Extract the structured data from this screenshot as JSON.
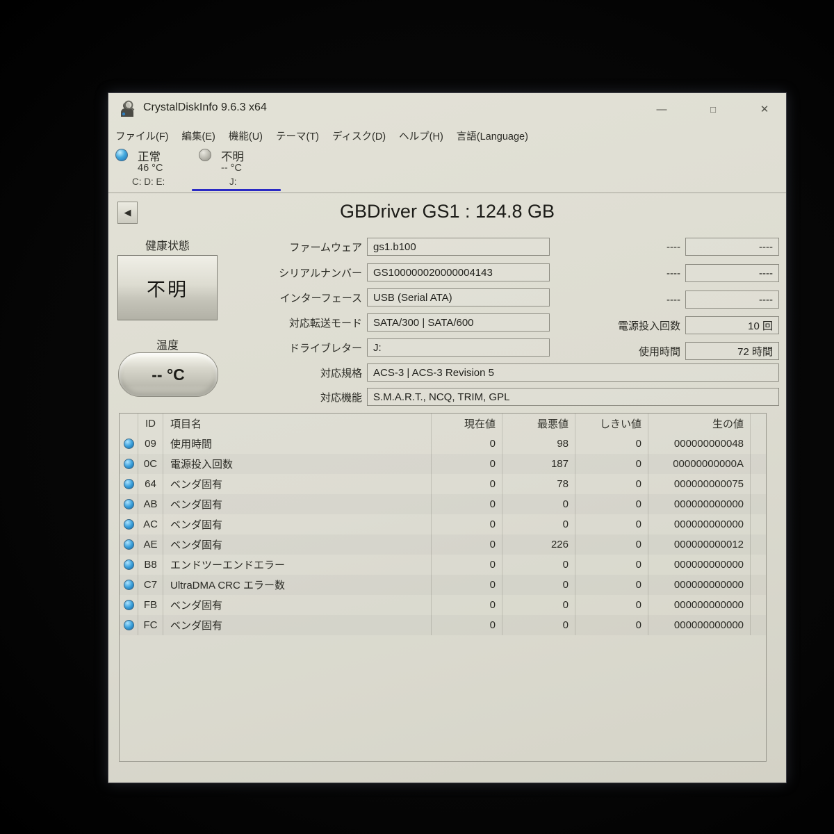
{
  "titlebar": {
    "title": "CrystalDiskInfo 9.6.3 x64",
    "minimize": "—",
    "maximize": "□",
    "close": "✕"
  },
  "menu": {
    "items": [
      {
        "label": "ファイル(F)"
      },
      {
        "label": "編集(E)"
      },
      {
        "label": "機能(U)"
      },
      {
        "label": "テーマ(T)"
      },
      {
        "label": "ディスク(D)"
      },
      {
        "label": "ヘルプ(H)"
      },
      {
        "label": "言語(Language)"
      }
    ]
  },
  "disks": {
    "tabs": [
      {
        "status": "正常",
        "temp": "46 °C",
        "drives": "C: D: E:",
        "selected": false
      },
      {
        "status": "不明",
        "temp": "-- °C",
        "drives": "J:",
        "selected": true
      }
    ],
    "good_dot_color": "#45aade",
    "unknown_dot_color": "#b9b8ae",
    "selected_underline_color": "#2a2ac4"
  },
  "main": {
    "back_button": "◀",
    "drive_title": "GBDriver GS1 : 124.8 GB",
    "health": {
      "label": "健康状態",
      "value": "不明"
    },
    "temperature": {
      "label": "温度",
      "value": "-- °C"
    },
    "fields": [
      {
        "label": "ファームウェア",
        "value": "gs1.b100"
      },
      {
        "label": "シリアルナンバー",
        "value": "GS100000020000004143"
      },
      {
        "label": "インターフェース",
        "value": "USB (Serial ATA)"
      },
      {
        "label": "対応転送モード",
        "value": "SATA/300 | SATA/600"
      },
      {
        "label": "ドライブレター",
        "value": "J:"
      },
      {
        "label": "対応規格",
        "value": "ACS-3 | ACS-3 Revision 5"
      },
      {
        "label": "対応機能",
        "value": "S.M.A.R.T., NCQ, TRIM, GPL"
      }
    ],
    "right_fields": [
      {
        "label": "----",
        "value": "----"
      },
      {
        "label": "----",
        "value": "----"
      },
      {
        "label": "----",
        "value": "----"
      },
      {
        "label": "電源投入回数",
        "value": "10 回"
      },
      {
        "label": "使用時間",
        "value": "72 時間"
      }
    ]
  },
  "smart": {
    "headers": {
      "id": "ID",
      "name": "項目名",
      "current": "現在値",
      "worst": "最悪値",
      "threshold": "しきい値",
      "raw": "生の値"
    },
    "rows": [
      {
        "id": "09",
        "name": "使用時間",
        "current": "0",
        "worst": "98",
        "threshold": "0",
        "raw": "000000000048"
      },
      {
        "id": "0C",
        "name": "電源投入回数",
        "current": "0",
        "worst": "187",
        "threshold": "0",
        "raw": "00000000000A"
      },
      {
        "id": "64",
        "name": "ベンダ固有",
        "current": "0",
        "worst": "78",
        "threshold": "0",
        "raw": "000000000075"
      },
      {
        "id": "AB",
        "name": "ベンダ固有",
        "current": "0",
        "worst": "0",
        "threshold": "0",
        "raw": "000000000000"
      },
      {
        "id": "AC",
        "name": "ベンダ固有",
        "current": "0",
        "worst": "0",
        "threshold": "0",
        "raw": "000000000000"
      },
      {
        "id": "AE",
        "name": "ベンダ固有",
        "current": "0",
        "worst": "226",
        "threshold": "0",
        "raw": "000000000012"
      },
      {
        "id": "B8",
        "name": "エンドツーエンドエラー",
        "current": "0",
        "worst": "0",
        "threshold": "0",
        "raw": "000000000000"
      },
      {
        "id": "C7",
        "name": "UltraDMA CRC エラー数",
        "current": "0",
        "worst": "0",
        "threshold": "0",
        "raw": "000000000000"
      },
      {
        "id": "FB",
        "name": "ベンダ固有",
        "current": "0",
        "worst": "0",
        "threshold": "0",
        "raw": "000000000000"
      },
      {
        "id": "FC",
        "name": "ベンダ固有",
        "current": "0",
        "worst": "0",
        "threshold": "0",
        "raw": "000000000000"
      }
    ]
  }
}
